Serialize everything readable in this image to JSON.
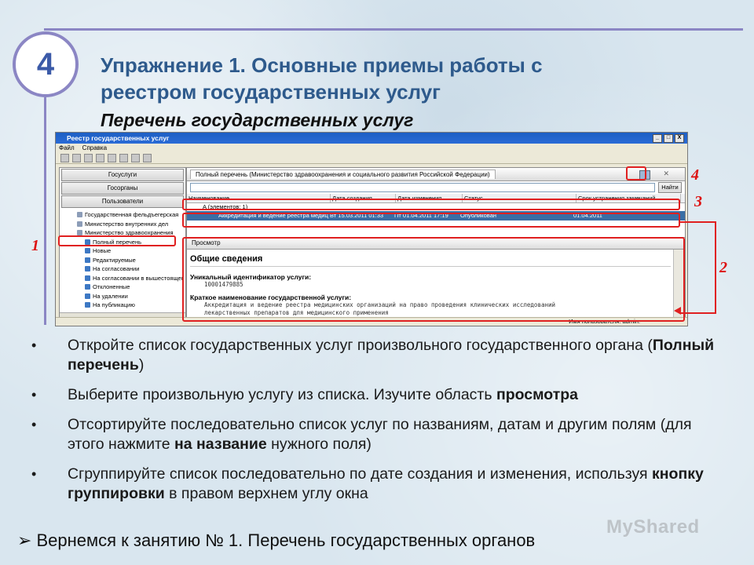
{
  "slide": {
    "number": "4",
    "title_line1": "Упражнение 1. Основные приемы работы с",
    "title_line2": "реестром государственных услуг",
    "subtitle": "Перечень государственных услуг"
  },
  "app": {
    "window_title": "Реестр государственных услуг",
    "window_buttons": [
      "_",
      "□",
      "X"
    ],
    "menu": [
      "Файл",
      "Справка"
    ],
    "left_buttons": [
      "Госуслуги",
      "Госорганы",
      "Пользователи"
    ],
    "tree": [
      {
        "label": "Государственная фельдъегерская",
        "kind": "doc"
      },
      {
        "label": "Министерство внутренних дел",
        "kind": "doc"
      },
      {
        "label": "Министерство здравоохранения",
        "kind": "doc"
      },
      {
        "label": "Полный перечень",
        "kind": "folder"
      },
      {
        "label": "Новые",
        "kind": "folder"
      },
      {
        "label": "Редактируемые",
        "kind": "folder"
      },
      {
        "label": "На согласовании",
        "kind": "folder"
      },
      {
        "label": "На согласовании в вышестоящем",
        "kind": "folder"
      },
      {
        "label": "Отклоненные",
        "kind": "folder"
      },
      {
        "label": "На удалении",
        "kind": "folder"
      },
      {
        "label": "На публикацию",
        "kind": "folder"
      }
    ],
    "tab_title": "Полный перечень (Министерство здравоохранения и социального развития Российской Федерации)",
    "search_button": "Найти",
    "columns": [
      "Наименование",
      "Дата создания",
      "Дата изменения",
      "Статус",
      "Срок устранения замечаний"
    ],
    "group_row": "A (элементов: 1)",
    "row": {
      "name": "Аккредитация и ведение реестра медицинских",
      "created": "Вт 15.03.2011 01:33",
      "modified": "Пт 01.04.2011 17:19",
      "status": "Опубликован",
      "deadline": "01.04.2011"
    },
    "preview_tab": "Просмотр",
    "preview": {
      "heading": "Общие сведения",
      "id_label": "Уникальный идентификатор услуги:",
      "id_value": "10001479885",
      "name_label": "Краткое наименование государственной услуги:",
      "name_value_1": "Аккредитация и ведение реестра медицинских организаций на право проведения клинических исследований",
      "name_value_2": "лекарственных препаратов для медицинского применения"
    },
    "status_user": "Имя пользователя: admin."
  },
  "annotations": [
    "1",
    "2",
    "3",
    "4"
  ],
  "bullets": [
    {
      "t1": "Откройте список государственных услуг произвольного государственного органа (",
      "b": "Полный перечень",
      "t2": ")"
    },
    {
      "t1": "Выберите произвольную услугу из списка. Изучите область ",
      "b": "просмотра",
      "t2": ""
    },
    {
      "t1": "Отсортируйте последовательно список услуг по названиям, датам и другим полям (для этого нажмите ",
      "b": "на название",
      "t2": " нужного поля)"
    },
    {
      "t1": "Сгруппируйте список последовательно по дате создания и изменения, используя ",
      "b": "кнопку группировки",
      "t2": " в правом верхнем углу окна"
    }
  ],
  "footer": {
    "arrow": "➢",
    "text": "Вернемся к занятию № 1. Перечень государственных органов"
  },
  "watermark": "MyShared",
  "colors": {
    "accent": "#8b86c4",
    "title": "#2e5a8c",
    "annotation": "#e02020",
    "selection": "#3a6ea5"
  }
}
